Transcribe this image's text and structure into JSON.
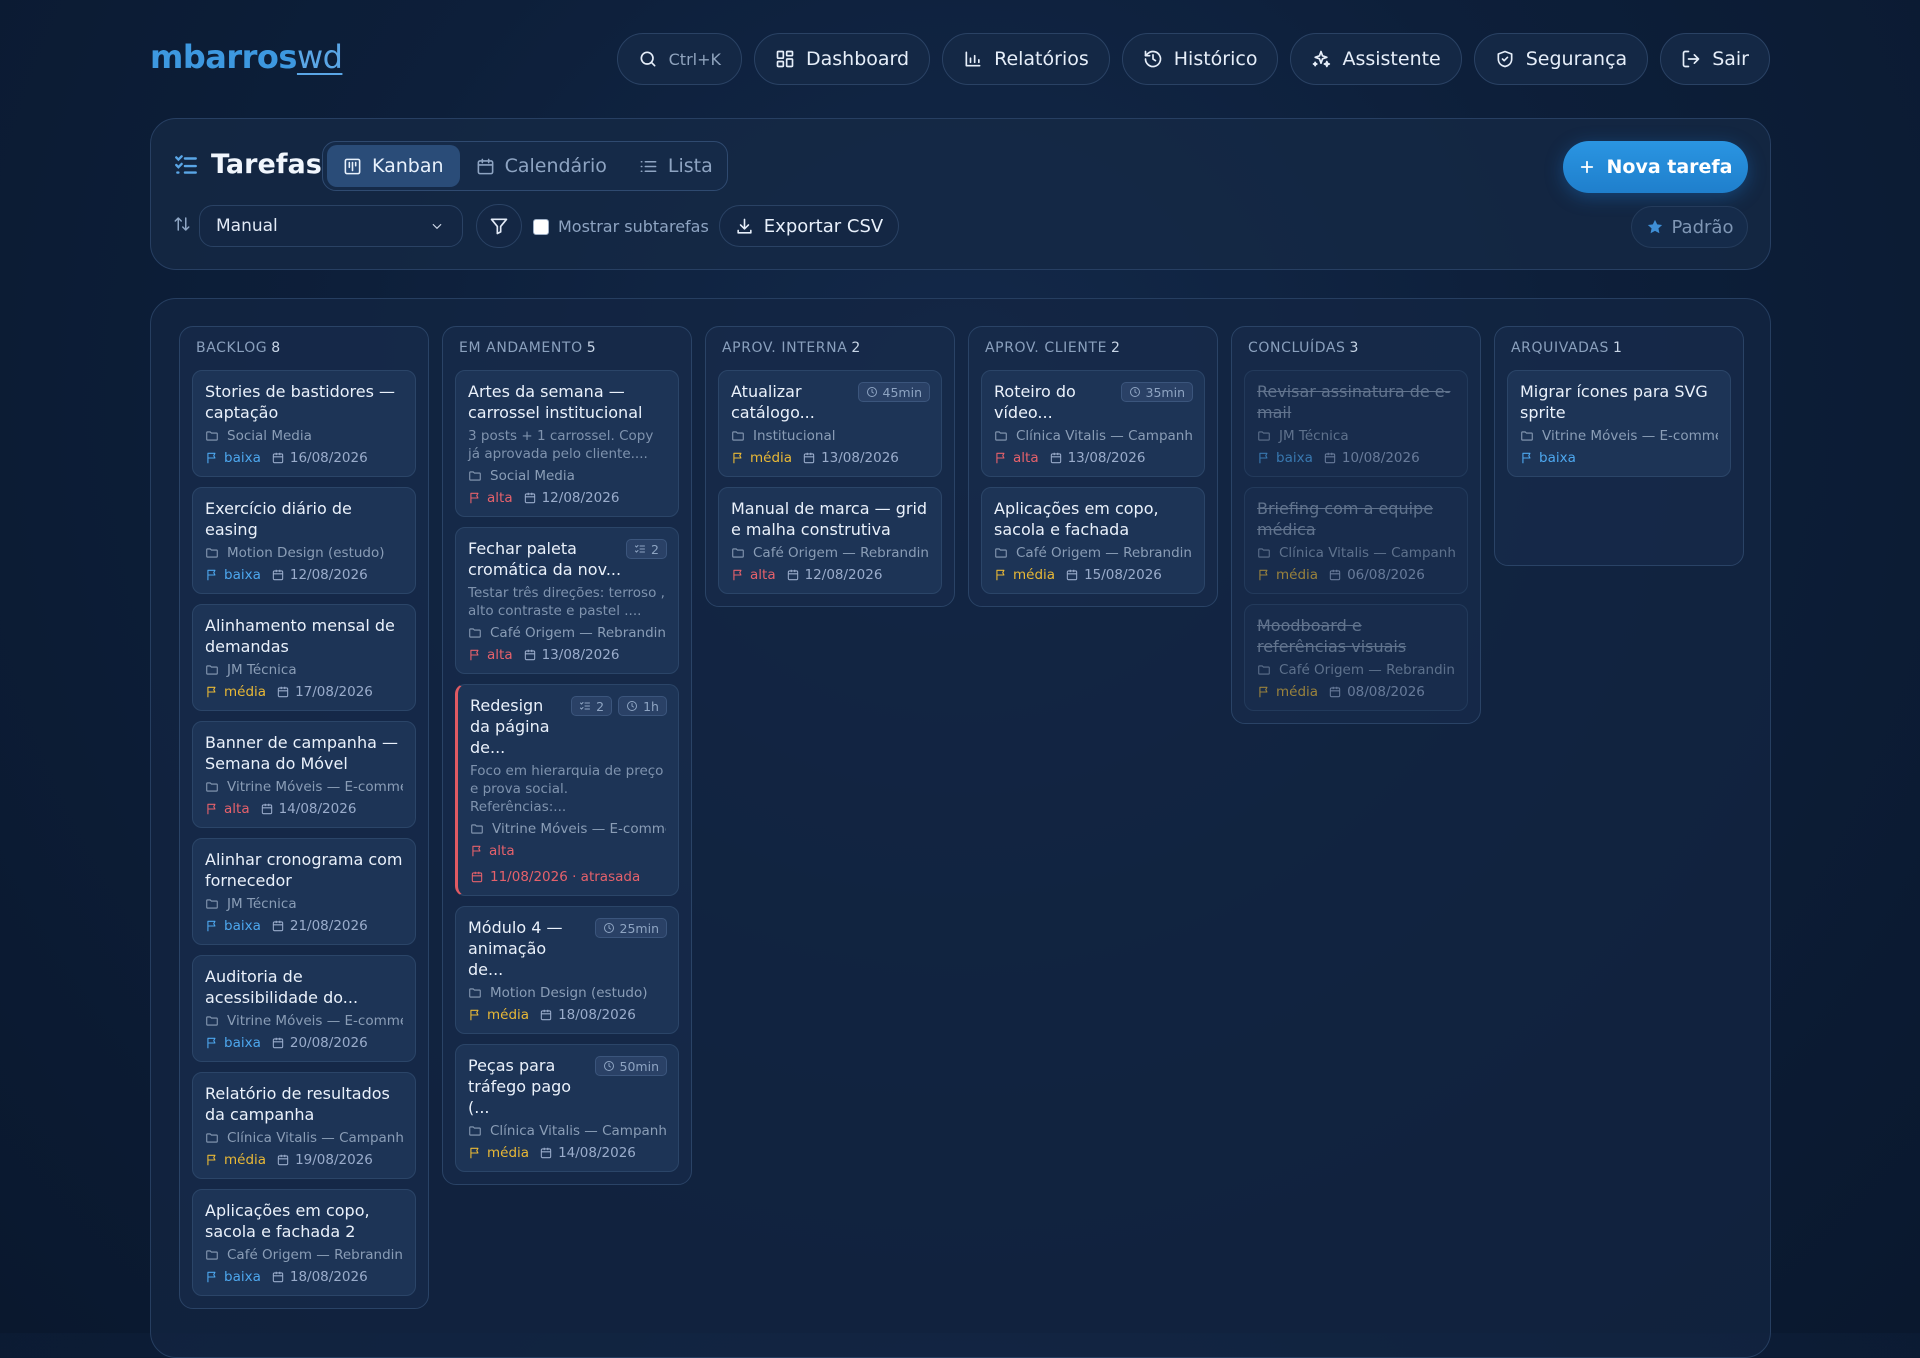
{
  "brand": {
    "part1": "mbarros",
    "part2": "wd"
  },
  "nav": {
    "search": "Ctrl+K",
    "dashboard": "Dashboard",
    "reports": "Relatórios",
    "history": "Histórico",
    "assistant": "Assistente",
    "security": "Segurança",
    "logout": "Sair"
  },
  "header": {
    "title": "Tarefas",
    "views": {
      "kanban": "Kanban",
      "calendar": "Calendário",
      "list": "Lista"
    },
    "new_task": "Nova tarefa",
    "sort_value": "Manual",
    "show_subtasks": "Mostrar subtarefas",
    "export_csv": "Exportar CSV",
    "preset": "Padrão"
  },
  "colors": {
    "accent": "#2a95e2",
    "baixa": "#4da7ee",
    "media": "#e8b836",
    "alta": "#e5616b"
  },
  "columns": {
    "backlog": {
      "name": "BACKLOG",
      "count": "8",
      "cards": [
        {
          "title": "Stories de bastidores — captação",
          "project": "Social Media",
          "priority": "baixa",
          "date": "16/08/2026"
        },
        {
          "title": "Exercício diário de easing",
          "project": "Motion Design (estudo)",
          "priority": "baixa",
          "date": "12/08/2026"
        },
        {
          "title": "Alinhamento mensal de demandas",
          "project": "JM Técnica",
          "priority": "média",
          "date": "17/08/2026"
        },
        {
          "title": "Banner de campanha — Semana do Móvel",
          "project": "Vitrine Móveis — E-commerce",
          "priority": "alta",
          "date": "14/08/2026"
        },
        {
          "title": "Alinhar cronograma com fornecedor",
          "project": "JM Técnica",
          "priority": "baixa",
          "date": "21/08/2026"
        },
        {
          "title": "Auditoria de acessibilidade do...",
          "project": "Vitrine Móveis — E-commerce",
          "priority": "baixa",
          "date": "20/08/2026"
        },
        {
          "title": "Relatório de resultados da campanha",
          "project": "Clínica Vitalis — Campanha",
          "priority": "média",
          "date": "19/08/2026"
        },
        {
          "title": "Aplicações em copo, sacola e fachada 2",
          "project": "Café Origem — Rebranding",
          "priority": "baixa",
          "date": "18/08/2026"
        }
      ]
    },
    "doing": {
      "name": "EM ANDAMENTO",
      "count": "5",
      "cards": [
        {
          "title": "Artes da semana — carrossel institucional",
          "desc": "3 posts + 1 carrossel. Copy já aprovada pelo cliente....",
          "project": "Social Media",
          "priority": "alta",
          "date": "12/08/2026"
        },
        {
          "title": "Fechar paleta cromática da nov...",
          "subtasks": "2",
          "desc": "Testar três direções: terroso , alto contraste e pastel ....",
          "project": "Café Origem — Rebranding",
          "priority": "alta",
          "date": "13/08/2026"
        },
        {
          "title": "Redesign da página de...",
          "subtasks": "2",
          "time": "1h",
          "desc": "Foco em hierarquia de preço e prova social. Referências:...",
          "project": "Vitrine Móveis — E-commerce",
          "priority": "alta",
          "date": "11/08/2026 · atrasada"
        },
        {
          "title": "Módulo 4 — animação de...",
          "time": "25min",
          "project": "Motion Design (estudo)",
          "priority": "média",
          "date": "18/08/2026"
        },
        {
          "title": "Peças para tráfego pago (...",
          "time": "50min",
          "project": "Clínica Vitalis — Campanha",
          "priority": "média",
          "date": "14/08/2026"
        }
      ]
    },
    "internal": {
      "name": "APROV. INTERNA",
      "count": "2",
      "cards": [
        {
          "title": "Atualizar catálogo...",
          "time": "45min",
          "project": "Institucional",
          "priority": "média",
          "date": "13/08/2026"
        },
        {
          "title": "Manual de marca — grid e malha construtiva",
          "project": "Café Origem — Rebranding",
          "priority": "alta",
          "date": "12/08/2026"
        }
      ]
    },
    "client": {
      "name": "APROV. CLIENTE",
      "count": "2",
      "cards": [
        {
          "title": "Roteiro do vídeo...",
          "time": "35min",
          "project": "Clínica Vitalis — Campanha",
          "priority": "alta",
          "date": "13/08/2026"
        },
        {
          "title": "Aplicações em copo, sacola e fachada",
          "project": "Café Origem — Rebranding",
          "priority": "média",
          "date": "15/08/2026"
        }
      ]
    },
    "done": {
      "name": "CONCLUÍDAS",
      "count": "3",
      "cards": [
        {
          "title": "Revisar assinatura de e-mail",
          "project": "JM Técnica",
          "priority": "baixa",
          "date": "10/08/2026"
        },
        {
          "title": "Briefing com a equipe médica",
          "project": "Clínica Vitalis — Campanha",
          "priority": "média",
          "date": "06/08/2026"
        },
        {
          "title": "Moodboard e referências visuais",
          "project": "Café Origem — Rebranding",
          "priority": "média",
          "date": "08/08/2026"
        }
      ]
    },
    "archived": {
      "name": "ARQUIVADAS",
      "count": "1",
      "cards": [
        {
          "title": "Migrar ícones para SVG sprite",
          "project": "Vitrine Móveis — E-commerce",
          "priority": "baixa"
        }
      ]
    }
  }
}
